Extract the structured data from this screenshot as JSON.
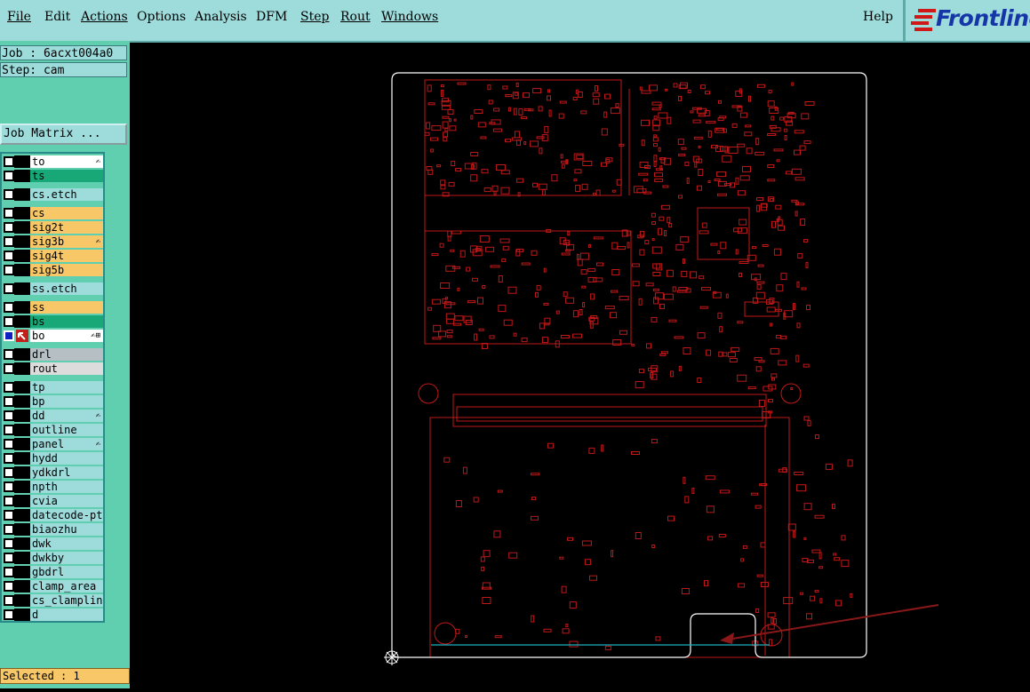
{
  "menu": {
    "file": "File",
    "edit": "Edit",
    "actions": "Actions",
    "options": "Options",
    "analysis": "Analysis",
    "dfm": "DFM",
    "step": "Step",
    "rout": "Rout",
    "windows": "Windows",
    "help": "Help"
  },
  "logo": {
    "text": "Frontline",
    "color": "#1636a8"
  },
  "info": {
    "job": "Job : 6acxt004a0",
    "step": "Step: cam",
    "job_matrix": "Job Matrix ..."
  },
  "layers": [
    {
      "name": "to",
      "color": "white",
      "mark": "✍"
    },
    {
      "name": "ts",
      "color": "green"
    },
    {
      "name": "cs.etch",
      "color": "cyan"
    },
    {
      "name": "cs",
      "color": "orange"
    },
    {
      "name": "sig2t",
      "color": "orange"
    },
    {
      "name": "sig3b",
      "color": "orange",
      "mark": "✍"
    },
    {
      "name": "sig4t",
      "color": "orange"
    },
    {
      "name": "sig5b",
      "color": "orange"
    },
    {
      "name": "ss.etch",
      "color": "cyan"
    },
    {
      "name": "ss",
      "color": "orange"
    },
    {
      "name": "bs",
      "color": "green"
    },
    {
      "name": "bo",
      "color": "white",
      "active": true,
      "mark": "✍⊞"
    },
    {
      "name": "drl",
      "color": "grey"
    },
    {
      "name": "rout",
      "color": "lgrey"
    },
    {
      "name": "tp",
      "color": "cyan"
    },
    {
      "name": "bp",
      "color": "cyan"
    },
    {
      "name": "dd",
      "color": "cyan",
      "mark": "✍"
    },
    {
      "name": "outline",
      "color": "cyan"
    },
    {
      "name": "panel",
      "color": "cyan",
      "mark": "✍"
    },
    {
      "name": "hydd",
      "color": "cyan"
    },
    {
      "name": "ydkdrl",
      "color": "cyan"
    },
    {
      "name": "npth",
      "color": "cyan"
    },
    {
      "name": "cvia",
      "color": "cyan"
    },
    {
      "name": "datecode-pt",
      "color": "cyan"
    },
    {
      "name": "biaozhu",
      "color": "cyan"
    },
    {
      "name": "dwk",
      "color": "cyan"
    },
    {
      "name": "dwkby",
      "color": "cyan"
    },
    {
      "name": "gbdrl",
      "color": "cyan"
    },
    {
      "name": "clamp_area",
      "color": "cyan"
    },
    {
      "name": "cs_clampline",
      "color": "cyan"
    },
    {
      "name": "d",
      "color": "cyan"
    }
  ],
  "status": {
    "selected": "Selected : 1"
  },
  "colors": {
    "panel_bg": "#5fcfb0",
    "menu_bg": "#9edcdc",
    "trace": "#c01818",
    "outline": "#ffffff",
    "highlight": "#18b0c0"
  }
}
